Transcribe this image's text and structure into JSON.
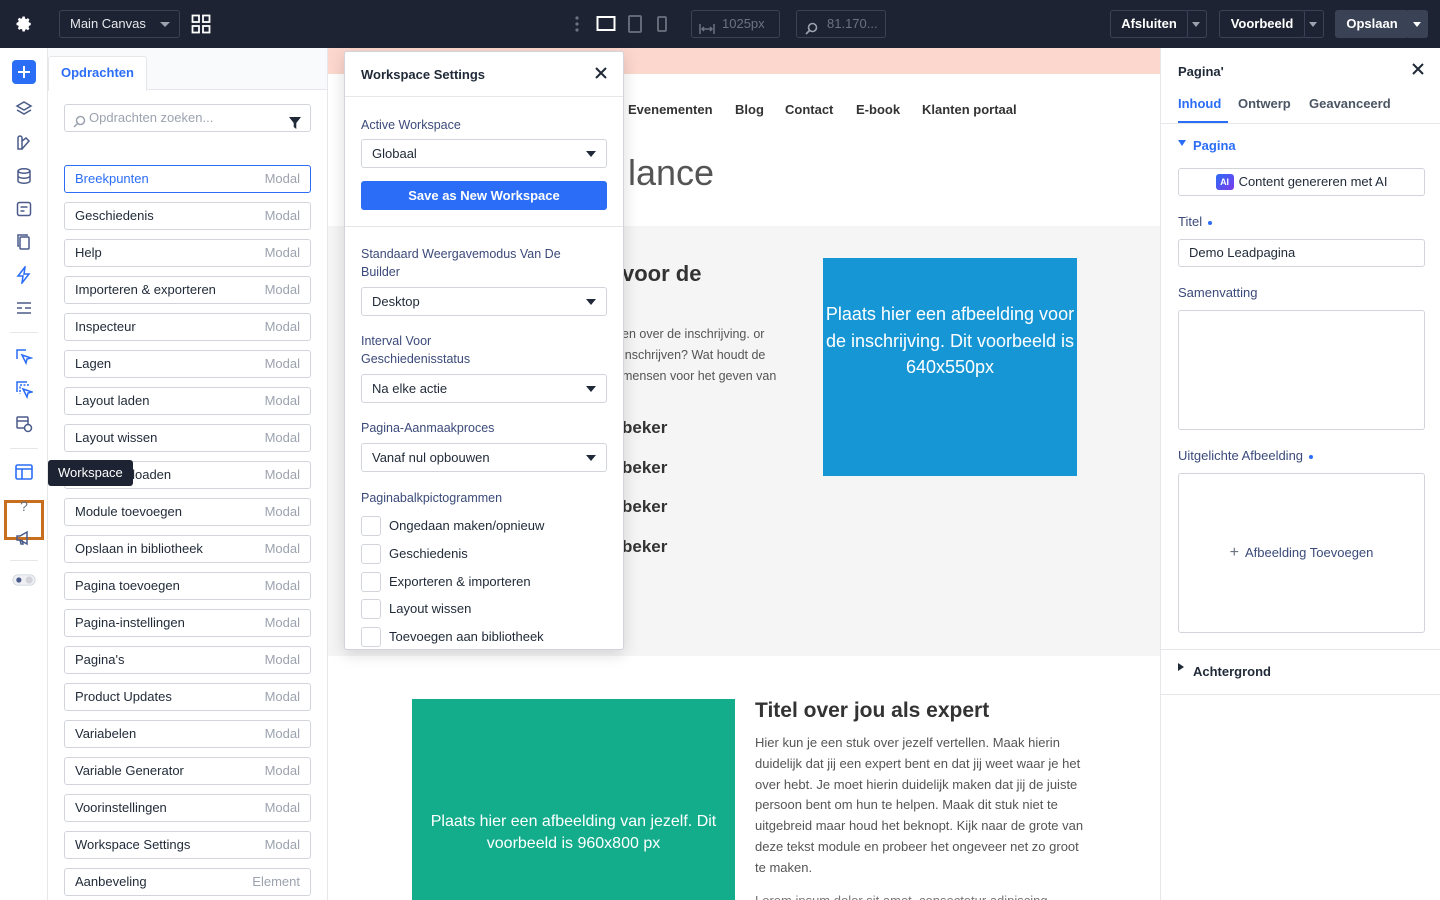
{
  "topbar": {
    "canvas_select": "Main Canvas",
    "width_value": "1025px",
    "zoom_value": "81.170...",
    "close_label": "Afsluiten",
    "preview_label": "Voorbeeld",
    "save_label": "Opslaan"
  },
  "rail": {
    "tooltip": "Workspace",
    "help_label": "?"
  },
  "left_panel": {
    "tab": "Opdrachten",
    "search_placeholder": "Opdrachten zoeken...",
    "commands": [
      {
        "label": "Breekpunten",
        "type": "Modal"
      },
      {
        "label": "Geschiedenis",
        "type": "Modal"
      },
      {
        "label": "Help",
        "type": "Modal"
      },
      {
        "label": "Importeren & exporteren",
        "type": "Modal"
      },
      {
        "label": "Inspecteur",
        "type": "Modal"
      },
      {
        "label": "Lagen",
        "type": "Modal"
      },
      {
        "label": "Layout laden",
        "type": "Modal"
      },
      {
        "label": "Layout wissen",
        "type": "Modal"
      },
      {
        "label": "Layout uploaden",
        "type": "Modal"
      },
      {
        "label": "Module toevoegen",
        "type": "Modal"
      },
      {
        "label": "Opslaan in bibliotheek",
        "type": "Modal"
      },
      {
        "label": "Pagina toevoegen",
        "type": "Modal"
      },
      {
        "label": "Pagina-instellingen",
        "type": "Modal"
      },
      {
        "label": "Pagina's",
        "type": "Modal"
      },
      {
        "label": "Product Updates",
        "type": "Modal"
      },
      {
        "label": "Variabelen",
        "type": "Modal"
      },
      {
        "label": "Variable Generator",
        "type": "Modal"
      },
      {
        "label": "Voorinstellingen",
        "type": "Modal"
      },
      {
        "label": "Workspace Settings",
        "type": "Modal"
      },
      {
        "label": "Aanbeveling",
        "type": "Element"
      }
    ]
  },
  "canvas": {
    "nav": [
      "Evenementen",
      "Blog",
      "Contact",
      "E-book",
      "Klanten portaal"
    ],
    "logo_text": "lance",
    "heading1": "voor de",
    "para1": "en over de inschrijving. or inschrijven? Wat houdt de mensen voor het geven van",
    "beker_items": [
      "beker",
      "beker",
      "beker",
      "beker"
    ],
    "bluebox_text": "Plaats hier een afbeelding voor de inschrijving. Dit voorbeeld is 640x550px",
    "greenbox_text": "Plaats hier een afbeelding van jezelf. Dit voorbeeld is 960x800 px",
    "heading2": "Titel over jou als expert",
    "para2": "Hier kun je een stuk over jezelf vertellen. Maak hierin duidelijk dat jij een expert bent en dat jij weet waar je het over hebt. Je moet hierin duidelijk maken dat jij de juiste persoon bent om hun te helpen. Maak dit stuk niet te uitgebreid maar houd het beknopt. Kijk naar de grote van deze tekst module en probeer het ongeveer net zo groot te maken.",
    "para3": "Lorem ipsum dolor sit amet, consectetur adipiscing"
  },
  "modal": {
    "title": "Workspace Settings",
    "active_workspace_label": "Active Workspace",
    "active_workspace_value": "Globaal",
    "save_new_label": "Save as New Workspace",
    "view_mode_label": "Standaard Weergavemodus Van De Builder",
    "view_mode_value": "Desktop",
    "history_interval_label": "Interval Voor Geschiedenisstatus",
    "history_interval_value": "Na elke actie",
    "page_creation_label": "Pagina-Aanmaakproces",
    "page_creation_value": "Vanaf nul opbouwen",
    "pagebar_icons_label": "Paginabalkpictogrammen",
    "checkboxes": [
      "Ongedaan maken/opnieuw",
      "Geschiedenis",
      "Exporteren & importeren",
      "Layout wissen",
      "Toevoegen aan bibliotheek"
    ]
  },
  "right_panel": {
    "title": "Pagina'",
    "tabs": [
      "Inhoud",
      "Ontwerp",
      "Geavanceerd"
    ],
    "section_page": "Pagina",
    "ai_button": "Content genereren met AI",
    "ai_badge": "AI",
    "title_label": "Titel",
    "title_value": "Demo Leadpagina",
    "summary_label": "Samenvatting",
    "summary_value": "",
    "featured_image_label": "Uitgelichte Afbeelding",
    "add_image_label": "Afbeelding Toevoegen",
    "section_background": "Achtergrond"
  },
  "colors": {
    "topbar": "#1d2332",
    "accent": "#2b6df6",
    "highlight": "#c86f1f",
    "blue_placeholder": "#1796d6",
    "green_placeholder": "#13ad8c",
    "banner": "#fcd7cd"
  }
}
